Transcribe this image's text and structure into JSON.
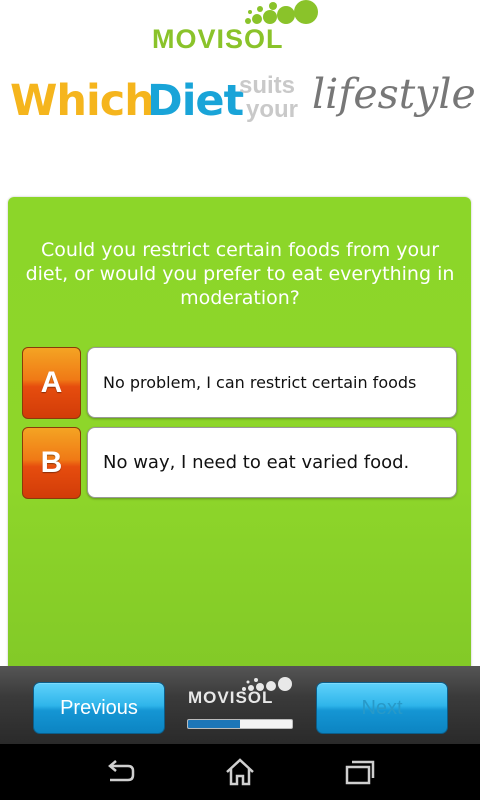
{
  "app": {
    "logo_text": "MOVISOL",
    "tagline": {
      "which": "Which",
      "diet": "Diet",
      "suits": "suits",
      "your": "your",
      "lifestyle": "lifestyle?"
    }
  },
  "question": {
    "text": "Could you restrict certain foods from your diet, or would you prefer to eat everything in moderation?",
    "answers": [
      {
        "letter": "A",
        "text": "No problem, I can restrict certain foods"
      },
      {
        "letter": "B",
        "text": "No way, I need to eat varied food."
      }
    ]
  },
  "footer": {
    "previous_label": "Previous",
    "next_label": "Next",
    "logo_text": "MOVISOL",
    "progress_fraction": 0.5
  },
  "system_nav": {
    "back_icon": "back-icon",
    "home_icon": "home-icon",
    "recents_icon": "recents-icon"
  },
  "colors": {
    "green_panel": "#8cd629",
    "orange_letter": "#f07a16",
    "blue_button": "#2fb5ea",
    "logo_green": "#8ac32a"
  }
}
